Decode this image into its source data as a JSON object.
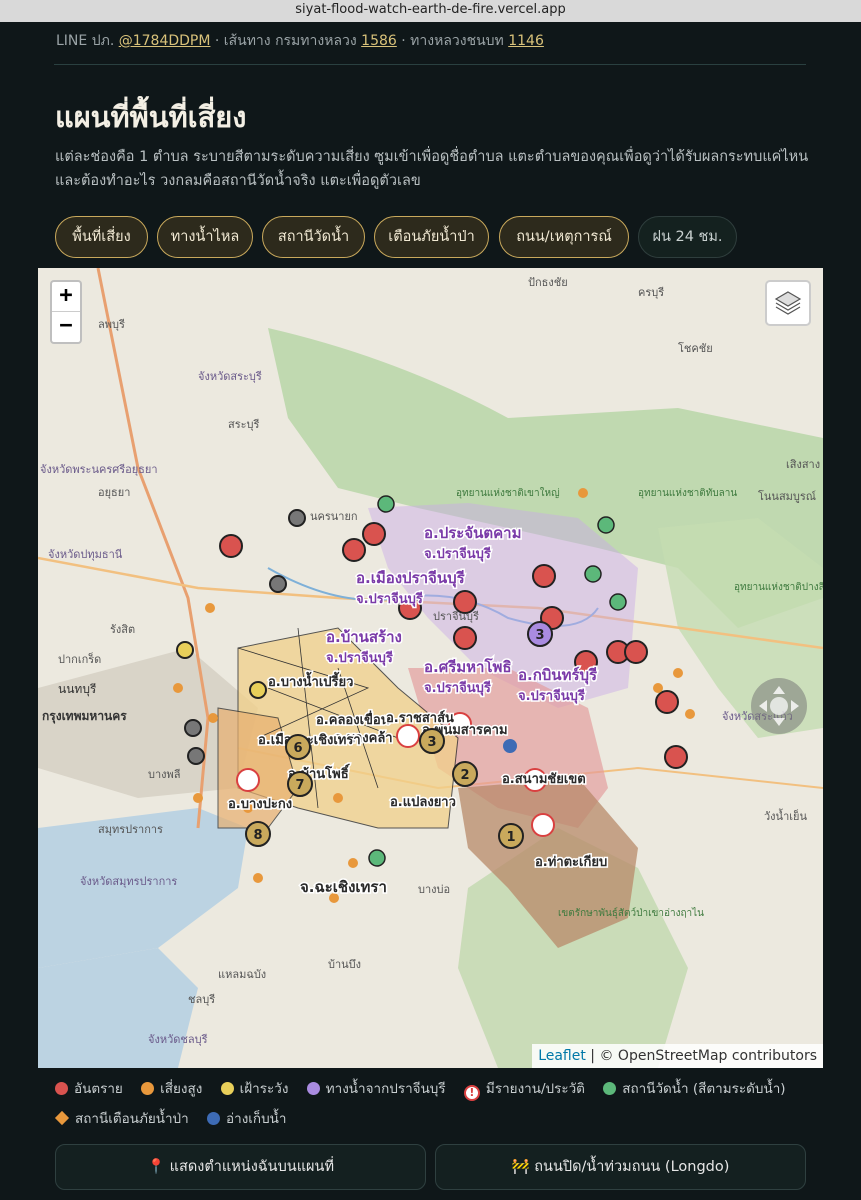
{
  "browser": {
    "url": "siyat-flood-watch-earth-de-fire.vercel.app"
  },
  "header": {
    "line_prefix": "LINE ปภ. ",
    "line_id": "@1784DDPM",
    "route_text": " · เส้นทาง กรมทางหลวง ",
    "highway_no": "1586",
    "rural_text": " · ทางหลวงชนบท ",
    "rural_no": "1146"
  },
  "page": {
    "title": "แผนที่พื้นที่เสี่ยง",
    "description": "แต่ละช่องคือ 1 ตำบล ระบายสีตามระดับความเสี่ยง ซูมเข้าเพื่อดูชื่อตำบล แตะตำบลของคุณเพื่อดูว่าได้รับผลกระทบแค่ไหนและต้องทำอะไร วงกลมคือสถานีวัดน้ำจริง แตะเพื่อดูตัวเลข"
  },
  "layer_chips": [
    {
      "label": "พื้นที่เสี่ยง",
      "active": true
    },
    {
      "label": "ทางน้ำไหล",
      "active": true
    },
    {
      "label": "สถานีวัดน้ำ",
      "active": true
    },
    {
      "label": "เตือนภัยน้ำป่า",
      "active": true
    },
    {
      "label": "ถนน/เหตุการณ์",
      "active": true
    },
    {
      "label": "ฝน 24 ชม.",
      "active": false
    }
  ],
  "map": {
    "zoom_in": "+",
    "zoom_out": "−",
    "attribution_leaflet": "Leaflet",
    "attribution_osm": " | © OpenStreetMap contributors",
    "district_labels": [
      "อ.ประจันตคาม",
      "จ.ปราจีนบุรี",
      "อ.เมืองปราจีนบุรี",
      "จ.ปราจีนบุรี",
      "อ.บ้านสร้าง",
      "จ.ปราจีนบุรี",
      "อ.ศรีมหาโพธิ",
      "จ.ปราจีนบุรี",
      "อ.กบินทร์บุรี",
      "จ.ปราจีนบุรี",
      "อ.บางน้ำเปรี้ยว",
      "อ.คลองเขื่อน",
      "อ.บางคล้า",
      "อ.ราชสาส์น",
      "อ.พนมสารคาม",
      "อ.เมืองฉะเชิงเทรา",
      "อ.บ้านโพธิ์",
      "อ.สนามชัยเขต",
      "อ.แปลงยาว",
      "อ.บางปะกง",
      "อ.ท่าตะเกียบ",
      "จ.ฉะเชิงเทรา"
    ],
    "base_labels": [
      "ลพบุรี",
      "สระบุรี",
      "นครนายก",
      "ปราจีนบุรี",
      "จังหวัดปทุมธานี",
      "รังสิต",
      "ปากเกร็ด",
      "นนทบุรี",
      "กรุงเทพมหานคร",
      "สมุทรปราการ",
      "จังหวัดสมุทรปราการ",
      "จังหวัดพระนครศรีอยุธยา",
      "อยุธยา",
      "อุทยานแห่งชาติเขาใหญ่",
      "อุทยานแห่งชาติทับลาน",
      "อุทยานแห่งชาติปางสีดา",
      "จังหวัดสระแก้ว",
      "วังน้ำเย็น",
      "ชลบุรี",
      "จังหวัดชลบุรี",
      "แหลมฉบัง",
      "บ้านบึง",
      "บางพลี",
      "เขตรักษาพันธุ์สัตว์ป่าเขาอ่างฤาไน",
      "ครบุรี",
      "เสิงสาง",
      "โนนสมบูรณ์",
      "ปักธงชัย",
      "โชคชัย",
      "จังหวัดสระบุรี",
      "บางบ่อ"
    ],
    "markers": [
      "1",
      "2",
      "3",
      "3",
      "6",
      "7",
      "8"
    ]
  },
  "legend": [
    {
      "type": "dot",
      "color": "#d9534f",
      "label": "อันตราย"
    },
    {
      "type": "dot",
      "color": "#e8983c",
      "label": "เสี่ยงสูง"
    },
    {
      "type": "dot",
      "color": "#e8cf5a",
      "label": "เฝ้าระวัง"
    },
    {
      "type": "dot",
      "color": "#a98be0",
      "label": "ทางน้ำจากปราจีนบุรี"
    },
    {
      "type": "warn",
      "color": "#d94040",
      "label": "มีรายงาน/ประวัติ"
    },
    {
      "type": "dot",
      "color": "#5cb87a",
      "label": "สถานีวัดน้ำ (สีตามระดับน้ำ)"
    },
    {
      "type": "diamond",
      "color": "#e8983c",
      "label": "สถานีเตือนภัยน้ำป่า"
    },
    {
      "type": "dot",
      "color": "#3d6bb5",
      "label": "อ่างเก็บน้ำ"
    }
  ],
  "buttons": {
    "show_location": "📍 แสดงตำแหน่งฉันบนแผนที่",
    "road_closures": "🚧 ถนนปิด/น้ำท่วมถนน (Longdo)"
  }
}
